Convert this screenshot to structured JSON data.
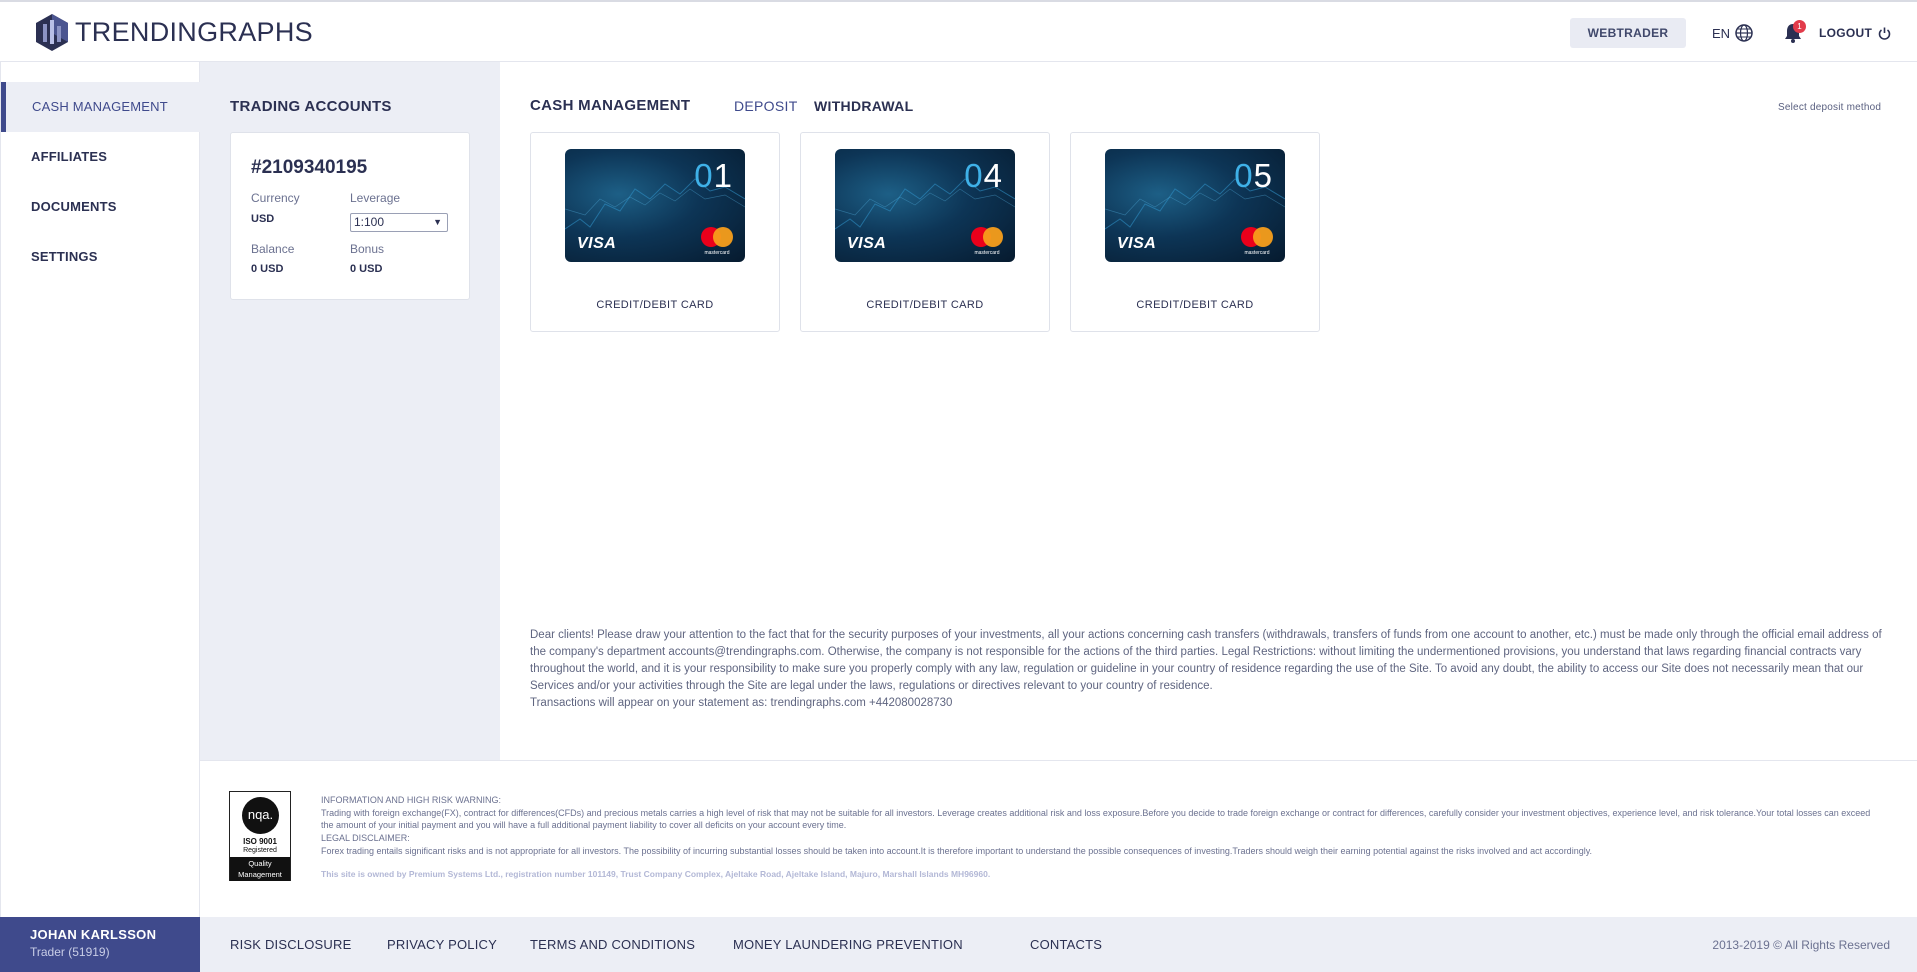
{
  "brand": {
    "name": "TRENDINGRAPHS"
  },
  "header": {
    "webtrader_label": "WEBTRADER",
    "language": "EN",
    "notification_count": "1",
    "logout_label": "LOGOUT"
  },
  "sidebar": {
    "items": [
      {
        "label": "CASH MANAGEMENT",
        "active": true
      },
      {
        "label": "AFFILIATES",
        "active": false
      },
      {
        "label": "DOCUMENTS",
        "active": false
      },
      {
        "label": "SETTINGS",
        "active": false
      }
    ],
    "user": {
      "name": "JOHAN KARLSSON",
      "role": "Trader (51919)"
    }
  },
  "accounts": {
    "title": "TRADING ACCOUNTS",
    "account": {
      "number": "#2109340195",
      "currency_label": "Currency",
      "currency_value": "USD",
      "leverage_label": "Leverage",
      "leverage_value": "1:100",
      "balance_label": "Balance",
      "balance_value": "0 USD",
      "bonus_label": "Bonus",
      "bonus_value": "0 USD"
    }
  },
  "main": {
    "title": "CASH MANAGEMENT",
    "tabs": [
      {
        "label": "DEPOSIT",
        "active": true
      },
      {
        "label": "WITHDRAWAL",
        "active": false
      }
    ],
    "select_method_hint": "Select deposit method",
    "methods": [
      {
        "card_number_prefix": "0",
        "card_number_suffix": "1",
        "visa": "VISA",
        "mc": "mastercard",
        "label": "CREDIT/DEBIT CARD"
      },
      {
        "card_number_prefix": "0",
        "card_number_suffix": "4",
        "visa": "VISA",
        "mc": "mastercard",
        "label": "CREDIT/DEBIT CARD"
      },
      {
        "card_number_prefix": "0",
        "card_number_suffix": "5",
        "visa": "VISA",
        "mc": "mastercard",
        "label": "CREDIT/DEBIT CARD"
      }
    ],
    "notice": "Dear clients! Please draw your attention to the fact that for the security purposes of your investments, all your actions concerning cash transfers (withdrawals, transfers of funds from one account to another, etc.) must be made only through the official email address of the company's department accounts@trendingraphs.com. Otherwise, the company is not responsible for the actions of the third parties. Legal Restrictions: without limiting the undermentioned provisions, you understand that laws regarding financial contracts vary throughout the world, and it is your responsibility to make sure you properly comply with any law, regulation or guideline in your country of residence regarding the use of the Site. To avoid any doubt, the ability to access our Site does not necessarily mean that our Services and/or your activities through the Site are legal under the laws, regulations or directives relevant to your country of residence.",
    "statement_note": "Transactions will appear on your statement as: trendingraphs.com +442080028730"
  },
  "footer": {
    "iso": {
      "logo": "nqa.",
      "line1": "ISO 9001",
      "line2": "Registered",
      "band1": "Quality",
      "band2": "Management"
    },
    "warning_title": "INFORMATION AND HIGH RISK WARNING:",
    "warning_text": "Trading with foreign exchange(FX), contract for differences(CFDs) and precious metals carries a high level of risk that may not be suitable for all investors. Leverage creates additional risk and loss exposure.Before you decide to trade foreign exchange or contract for differences, carefully consider your investment objectives, experience level, and risk tolerance.Your total losses can exceed the amount of your initial payment and you will have a full additional payment liability to cover all deficits on your account every time.",
    "legal_title": "LEGAL DISCLAIMER:",
    "legal_text": "Forex trading entails significant risks and is not appropriate for all investors. The possibility of incurring substantial losses should be taken into account.It is therefore important to understand the possible consequences of investing.Traders should weigh their earning potential against the risks involved and act accordingly.",
    "owned_text": "This site is owned by Premium Systems Ltd., registration number 101149, Trust Company Complex, Ajeltake Road, Ajeltake Island, Majuro, Marshall Islands MH96960.",
    "links": [
      "RISK DISCLOSURE",
      "PRIVACY POLICY",
      "TERMS AND CONDITIONS",
      "MONEY LAUNDERING PREVENTION",
      "CONTACTS"
    ],
    "copyright": "2013-2019 © All Rights Reserved"
  },
  "colors": {
    "accent": "#3f4a8c",
    "panel_bg": "#eceef5",
    "card_highlight": "#3fb1e8",
    "badge": "#e23b4a"
  }
}
